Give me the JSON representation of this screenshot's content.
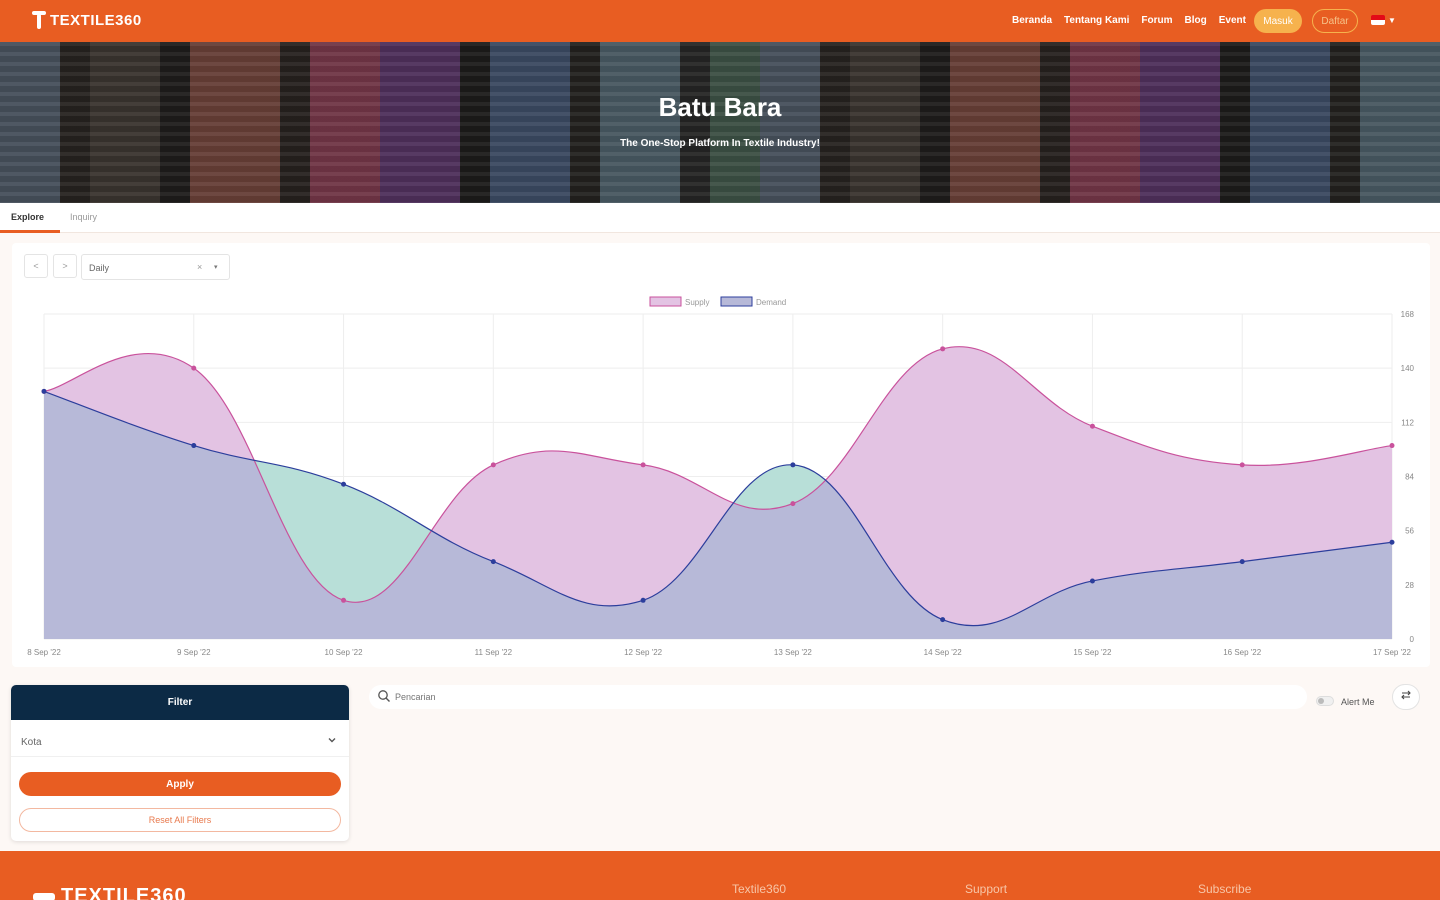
{
  "nav": {
    "logo_text": "TEXTILE360",
    "links": [
      "Beranda",
      "Tentang Kami",
      "Forum",
      "Blog",
      "Event"
    ],
    "masuk_label": "Masuk",
    "daftar_label": "Daftar",
    "language_flag": "flag-icon"
  },
  "hero": {
    "title": "Batu Bara",
    "subtitle": "The One-Stop Platform In Textile Industry!"
  },
  "tabs": {
    "explore": "Explore",
    "inquiry": "Inquiry"
  },
  "controls": {
    "prev": "<",
    "next": ">",
    "period_value": "Daily",
    "clear": "×",
    "dropdown": "▾"
  },
  "chart_data": {
    "type": "area",
    "x": [
      "8 Sep '22",
      "9 Sep '22",
      "10 Sep '22",
      "11 Sep '22",
      "12 Sep '22",
      "13 Sep '22",
      "14 Sep '22",
      "15 Sep '22",
      "16 Sep '22",
      "17 Sep '22"
    ],
    "series": [
      {
        "name": "Supply",
        "values": [
          128,
          140,
          20,
          90,
          90,
          70,
          150,
          110,
          90,
          100
        ],
        "color": "#c9529c",
        "fill": "#e3c3e3"
      },
      {
        "name": "Demand",
        "values": [
          128,
          100,
          80,
          40,
          20,
          90,
          10,
          30,
          40,
          50
        ],
        "color": "#2c3e9c",
        "fill": "#b7b9d8"
      }
    ],
    "y_ticks": [
      "0",
      "28",
      "56",
      "84",
      "112",
      "140",
      "168"
    ],
    "ylim": [
      0,
      168
    ],
    "grid": true,
    "legend": "top-center",
    "overlap_color": "#b8dfd8"
  },
  "filter": {
    "title": "Filter",
    "select_label": "Kota",
    "apply": "Apply",
    "reset": "Reset All Filters"
  },
  "search": {
    "placeholder": "Pencarian",
    "alert_label": "Alert Me"
  },
  "footer": {
    "logo_text": "TEXTILE360",
    "columns": [
      "Textile360",
      "Support",
      "Subscribe"
    ]
  },
  "colors": {
    "brand": "#e85d22",
    "navy": "#0c2a45",
    "accent": "#f6b24d"
  }
}
